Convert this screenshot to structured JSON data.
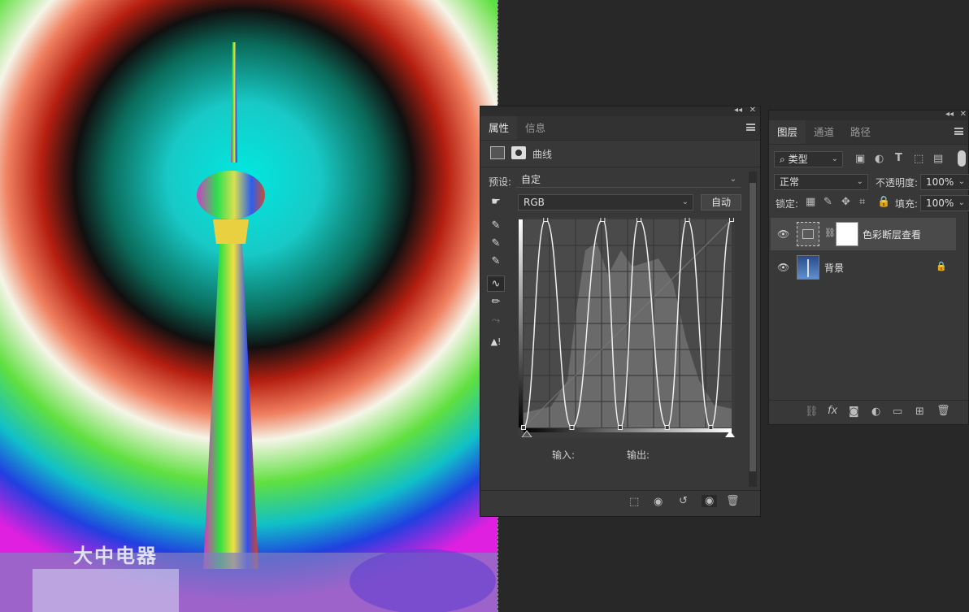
{
  "properties_panel": {
    "tabs": [
      {
        "label": "属性",
        "active": true
      },
      {
        "label": "信息",
        "active": false
      }
    ],
    "adjustment_title": "曲线",
    "preset_label": "预设:",
    "preset_value": "自定",
    "channel_value": "RGB",
    "auto_button": "自动",
    "input_label": "输入:",
    "output_label": "输出:"
  },
  "layers_panel": {
    "tabs": [
      {
        "label": "图层",
        "active": true
      },
      {
        "label": "通道",
        "active": false
      },
      {
        "label": "路径",
        "active": false
      }
    ],
    "filter_kind": "类型",
    "blend_mode": "正常",
    "opacity_label": "不透明度:",
    "opacity_value": "100%",
    "lock_label": "锁定:",
    "fill_label": "填充:",
    "fill_value": "100%",
    "layers": [
      {
        "name": "色彩断层查看",
        "selected": true,
        "type": "curves-adjustment"
      },
      {
        "name": "背景",
        "selected": false,
        "type": "background",
        "locked": true
      }
    ]
  },
  "canvas": {
    "sign_text": "大中电器"
  },
  "curve": {
    "points": [
      [
        0,
        0
      ],
      [
        33,
        255
      ],
      [
        72,
        0
      ],
      [
        118,
        255
      ],
      [
        144,
        0
      ],
      [
        172,
        255
      ],
      [
        214,
        0
      ],
      [
        244,
        255
      ],
      [
        279,
        0
      ],
      [
        310,
        255
      ]
    ],
    "input_max": 310
  },
  "colors": {
    "panel_bg": "#383838",
    "workspace_bg": "#282828",
    "selected_row": "#4a4a4a"
  }
}
